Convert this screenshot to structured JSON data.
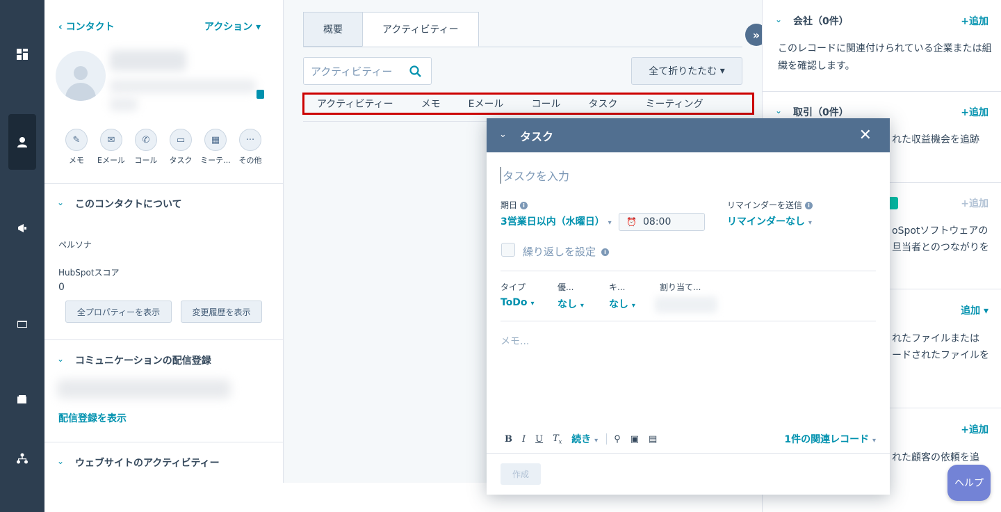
{
  "rail": {
    "items": [
      "dashboard-icon",
      "contacts-icon",
      "marketing-icon",
      "inbox-icon",
      "wallet-icon",
      "org-icon"
    ]
  },
  "contact": {
    "back_label": "コンタクト",
    "actions_label": "アクション",
    "quick_actions": [
      "メモ",
      "Eメール",
      "コール",
      "タスク",
      "ミーテ...",
      "その他"
    ],
    "about_title": "このコンタクトについて",
    "persona_label": "ペルソナ",
    "score_label": "HubSpotスコア",
    "score_value": "0",
    "show_all_props": "全プロパティーを表示",
    "show_history": "変更履歴を表示",
    "comm_title": "コミュニケーションの配信登録",
    "show_subscriptions": "配信登録を表示",
    "web_activity_title": "ウェブサイトのアクティビティー"
  },
  "activity": {
    "tabs": [
      "概要",
      "アクティビティー"
    ],
    "search_placeholder": "アクティビティー",
    "collapse_all": "全て折りたたむ",
    "filters": [
      "アクティビティー",
      "メモ",
      "Eメール",
      "コール",
      "タスク",
      "ミーティング"
    ]
  },
  "right": {
    "company_title": "会社（0件）",
    "company_add": "+追加",
    "company_text": "このレコードに関連付けられている企業または組織を確認します。",
    "deals_title": "取引（0件）",
    "deals_add": "+追加",
    "deals_frag": "れた収益機会を追跡",
    "third_add": "+追加",
    "third_frag1": "oSpotソフトウェアの",
    "third_frag2": "旦当者とのつながりを",
    "files_add": "追加",
    "files_frag1": "れたファイルまたは",
    "files_frag2": "ードされたファイルを",
    "tickets_add": "+追加",
    "tickets_frag": "れた顧客の依頼を追"
  },
  "help_label": "ヘルプ",
  "task": {
    "header": "タスク",
    "title_placeholder": "タスクを入力",
    "due_label": "期日",
    "due_value": "3営業日以内（水曜日）",
    "time_value": "08:00",
    "reminder_label": "リマインダーを送信",
    "reminder_value": "リマインダーなし",
    "repeat_label": "繰り返しを設定",
    "type_label": "タイプ",
    "type_value": "ToDo",
    "priority_label": "優...",
    "priority_value": "なし",
    "queue_label": "キ...",
    "queue_value": "なし",
    "assign_label": "割り当て...",
    "memo_placeholder": "メモ...",
    "toolbar_more": "続き",
    "related_records": "1件の関連レコード",
    "create_button": "作成"
  },
  "colors": {
    "accent": "#0091ae",
    "rail": "#2d3e50",
    "modal_header": "#516f90",
    "highlight": "#cc0000"
  }
}
